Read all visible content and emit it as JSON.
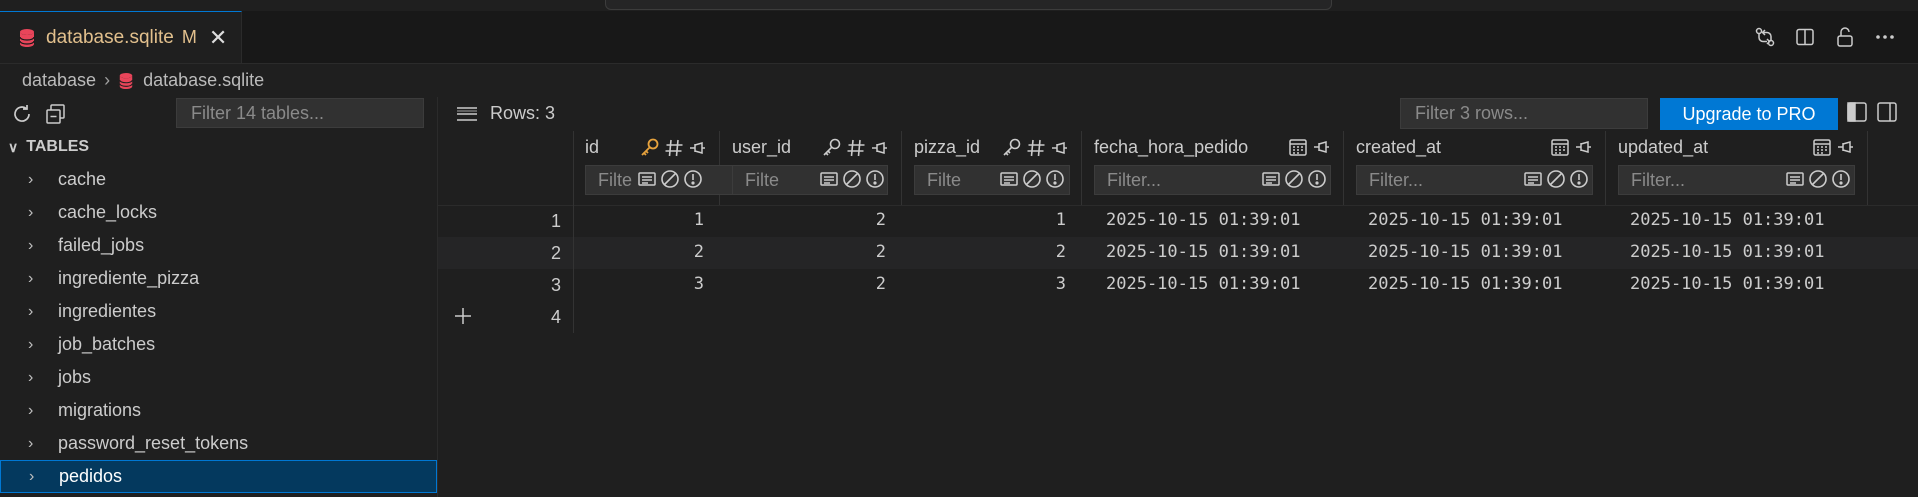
{
  "tab": {
    "label": "database.sqlite",
    "modified": "M",
    "close": "✕"
  },
  "breadcrumb": {
    "folder": "database",
    "file": "database.sqlite"
  },
  "sidebar": {
    "filter_placeholder": "Filter 14 tables...",
    "section_title": "TABLES",
    "tables": [
      "cache",
      "cache_locks",
      "failed_jobs",
      "ingrediente_pizza",
      "ingredientes",
      "job_batches",
      "jobs",
      "migrations",
      "password_reset_tokens",
      "pedidos"
    ],
    "selected": "pedidos"
  },
  "grid": {
    "rows_label": "Rows: 3",
    "row_filter_placeholder": "Filter 3 rows...",
    "upgrade_label": "Upgrade to PRO",
    "columns": [
      {
        "name": "id",
        "filter_placeholder": "Filte"
      },
      {
        "name": "user_id",
        "filter_placeholder": "Filte"
      },
      {
        "name": "pizza_id",
        "filter_placeholder": "Filte"
      },
      {
        "name": "fecha_hora_pedido",
        "filter_placeholder": "Filter..."
      },
      {
        "name": "created_at",
        "filter_placeholder": "Filter..."
      },
      {
        "name": "updated_at",
        "filter_placeholder": "Filter..."
      }
    ],
    "rows": [
      {
        "n": "1",
        "id": "1",
        "user_id": "2",
        "pizza_id": "1",
        "fecha_hora_pedido": "2025-10-15 01:39:01",
        "created_at": "2025-10-15 01:39:01",
        "updated_at": "2025-10-15 01:39:01"
      },
      {
        "n": "2",
        "id": "2",
        "user_id": "2",
        "pizza_id": "2",
        "fecha_hora_pedido": "2025-10-15 01:39:01",
        "created_at": "2025-10-15 01:39:01",
        "updated_at": "2025-10-15 01:39:01"
      },
      {
        "n": "3",
        "id": "3",
        "user_id": "2",
        "pizza_id": "3",
        "fecha_hora_pedido": "2025-10-15 01:39:01",
        "created_at": "2025-10-15 01:39:01",
        "updated_at": "2025-10-15 01:39:01"
      }
    ],
    "new_row_number": "4"
  },
  "colors": {
    "accent": "#0078d4",
    "modified": "#e2c08d",
    "primary_key": "#e8a33d",
    "db_icon": "#e8455a"
  }
}
